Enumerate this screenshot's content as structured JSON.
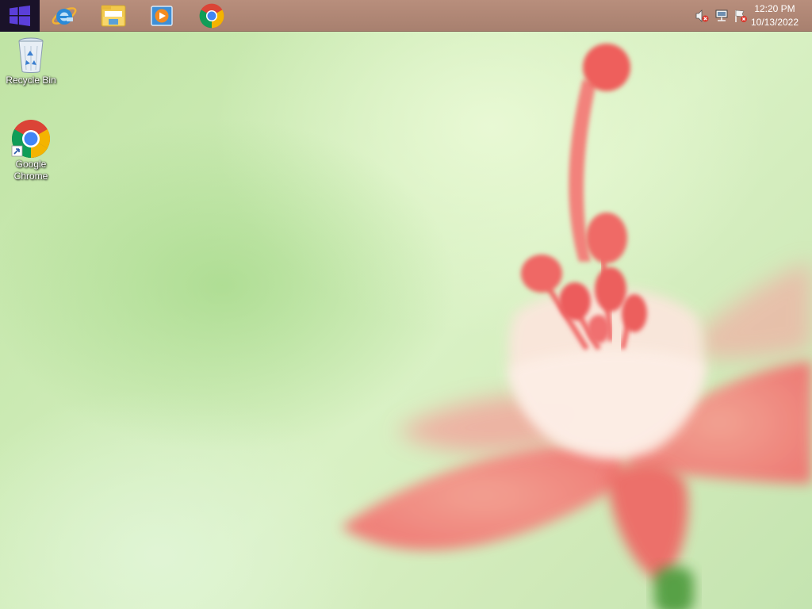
{
  "taskbar": {
    "start_icon": "windows-logo-icon",
    "pinned": [
      {
        "name": "Internet Explorer",
        "icon": "internet-explorer-icon"
      },
      {
        "name": "File Explorer",
        "icon": "folder-icon"
      },
      {
        "name": "Windows Media Player",
        "icon": "media-player-icon"
      },
      {
        "name": "Google Chrome",
        "icon": "chrome-icon"
      }
    ],
    "tray": {
      "icons": [
        "speaker-muted-icon",
        "network-icon",
        "action-center-flag-icon"
      ],
      "time": "12:20 PM",
      "date": "10/13/2022"
    }
  },
  "desktop": {
    "icons": [
      {
        "label": "Recycle Bin",
        "icon": "recycle-bin-icon"
      },
      {
        "label": "Google Chrome",
        "icon": "chrome-icon"
      }
    ]
  },
  "colors": {
    "taskbar": "#a8806f",
    "start_button": "#1a1229",
    "windows_logo": "#5b3fd9",
    "wallpaper_green": "#cbeab3",
    "flower_pink": "#f07c7c"
  }
}
